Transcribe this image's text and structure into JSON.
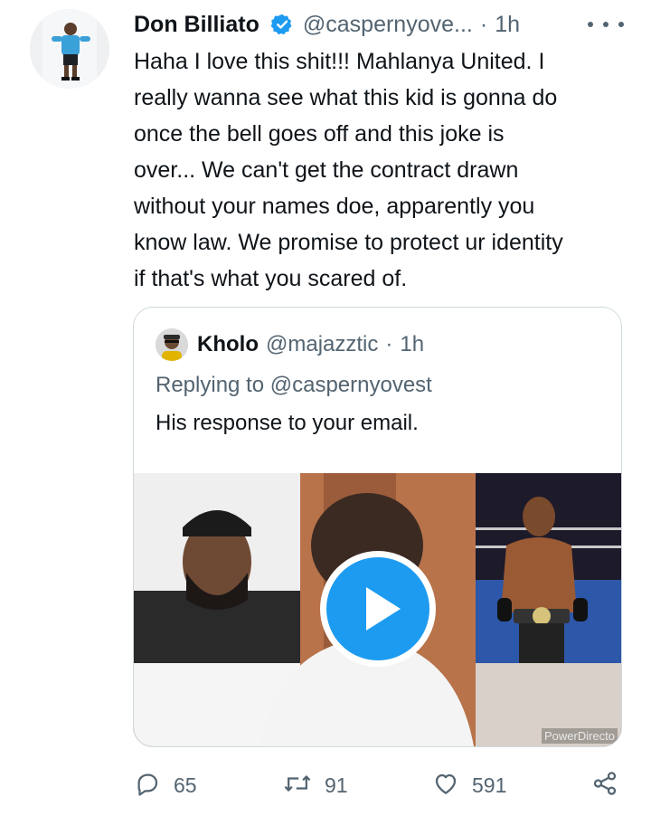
{
  "tweet": {
    "author_name": "Don Billiato",
    "handle": "@caspernyove...",
    "separator": "·",
    "time": "1h",
    "text": "Haha I love this shit!!! Mahlanya United. I\nreally wanna see what this kid is gonna do\nonce the bell goes off and this joke is\nover... We can't get the contract drawn\nwithout your names doe, apparently you\nknow law. We promise to protect ur identity\nif that's what you scared of.",
    "icons": {
      "verified": "verified-badge-icon",
      "more": "more-options-icon"
    },
    "accent_color": "#1d9bf0"
  },
  "quote": {
    "author_name": "Kholo",
    "handle": "@majazztic",
    "separator": "·",
    "time": "1h",
    "replying_to": "Replying to @caspernyovest",
    "text": "His response to your email.",
    "media": {
      "type": "video",
      "watermark": "PowerDirecto",
      "icons": {
        "play": "play-icon"
      }
    }
  },
  "actions": {
    "reply_count": "65",
    "retweet_count": "91",
    "like_count": "591",
    "icons": {
      "reply": "reply-icon",
      "retweet": "retweet-icon",
      "like": "heart-icon",
      "share": "share-icon"
    }
  }
}
